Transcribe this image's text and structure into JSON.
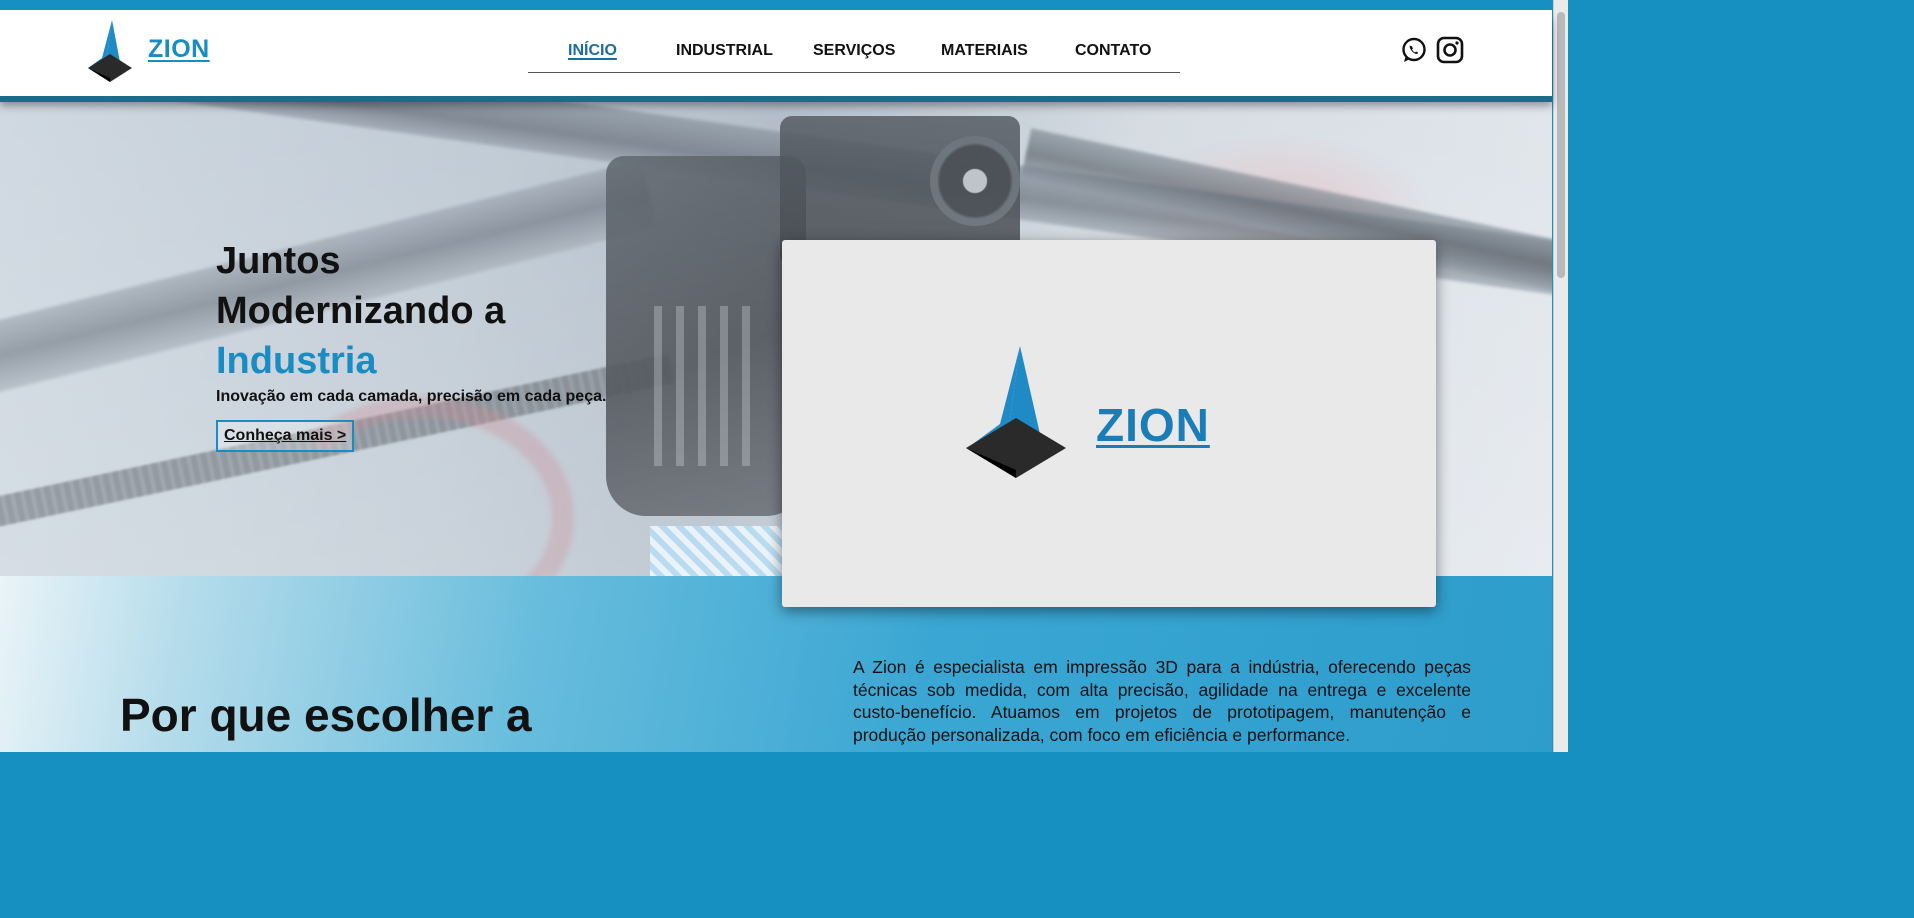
{
  "header": {
    "brand": "ZION",
    "nav": [
      {
        "label": "INÍCIO",
        "active": true
      },
      {
        "label": "INDUSTRIAL",
        "active": false
      },
      {
        "label": "SERVIÇOS",
        "active": false
      },
      {
        "label": "MATERIAIS",
        "active": false
      },
      {
        "label": "CONTATO",
        "active": false
      }
    ],
    "social": [
      "whatsapp-icon",
      "instagram-icon"
    ]
  },
  "hero": {
    "title_line1": "Juntos",
    "title_line2": "Modernizando a",
    "title_accent": "Industria",
    "subtitle": "Inovação em cada camada, precisão em cada peça.",
    "cta_label": "Conheça mais >"
  },
  "card": {
    "brand": "ZION"
  },
  "section": {
    "why_title": "Por que escolher a",
    "about_text": "A Zion é especialista em impressão 3D para a indústria, oferecendo peças técnicas sob medida, com alta precisão, agilidade na entrega e excelente custo-benefício. Atuamos em projetos de prototipagem, manutenção e produção personalizada, com foco em eficiência e performance."
  },
  "colors": {
    "accent": "#1a8cc4",
    "frame": "#1590c0",
    "dark": "#111111"
  }
}
